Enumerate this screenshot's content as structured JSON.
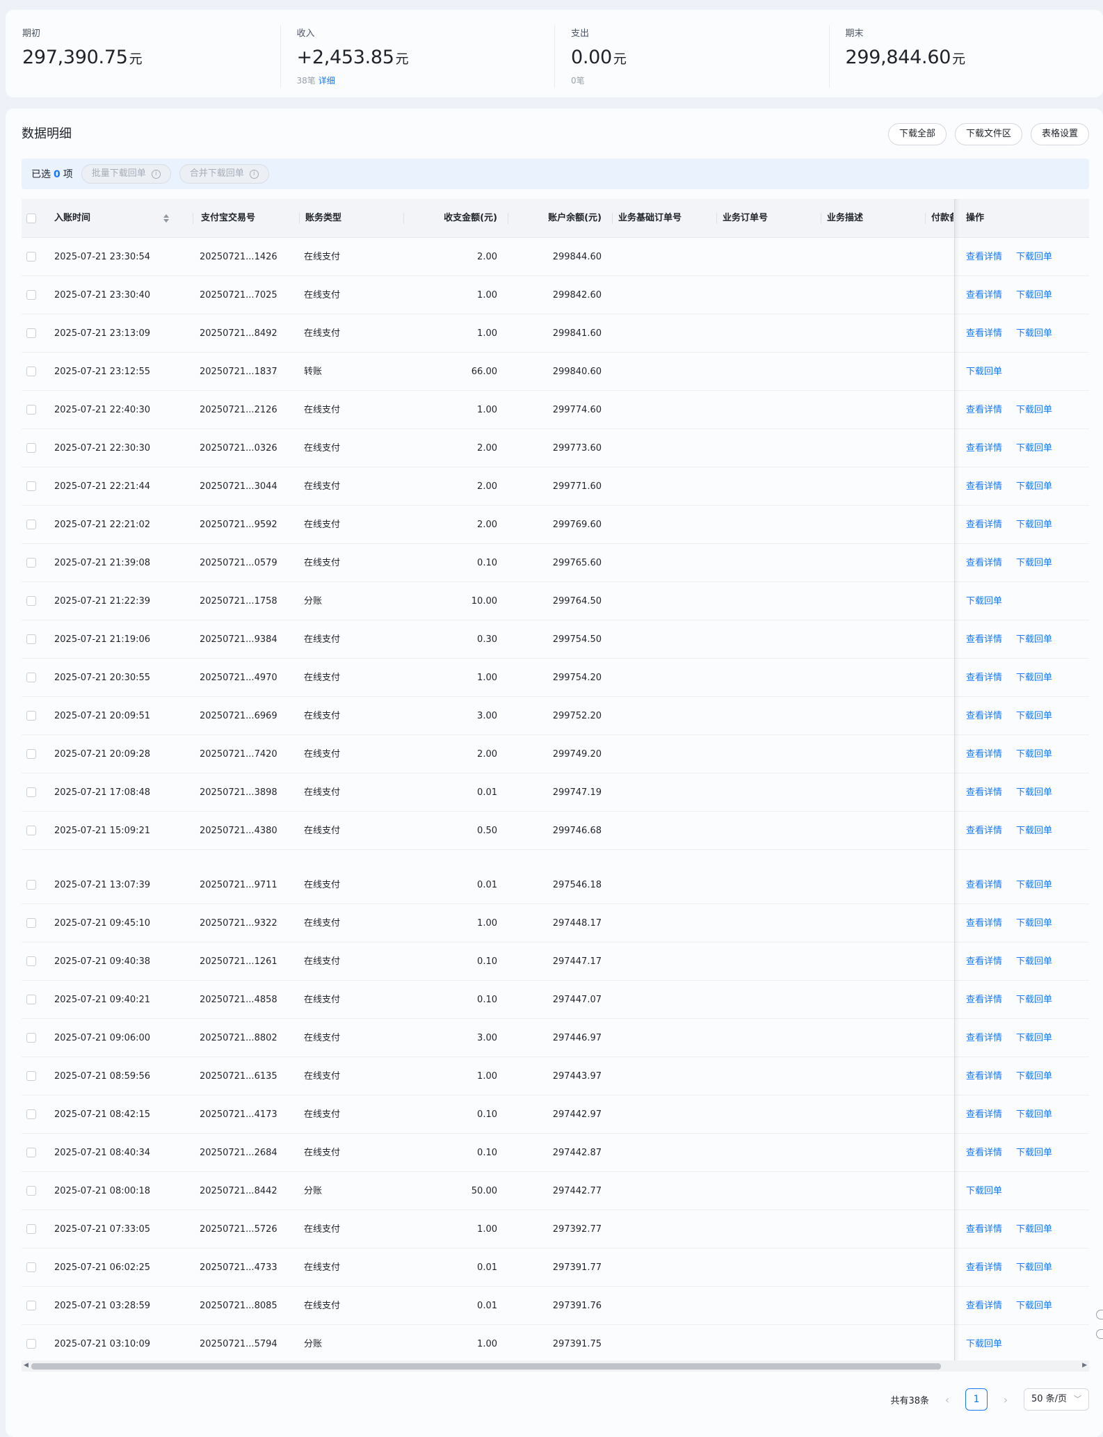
{
  "summary": [
    {
      "label": "期初",
      "value": "297,390.75",
      "unit": "元",
      "sub": "",
      "sub_link": ""
    },
    {
      "label": "收入",
      "value": "+2,453.85",
      "unit": "元",
      "sub": "38笔",
      "sub_link": "详细"
    },
    {
      "label": "支出",
      "value": "0.00",
      "unit": "元",
      "sub": "0笔",
      "sub_link": ""
    },
    {
      "label": "期末",
      "value": "299,844.60",
      "unit": "元",
      "sub": "",
      "sub_link": ""
    }
  ],
  "section_title": "数据明细",
  "toolbar": {
    "download_all": "下载全部",
    "download_files": "下载文件区",
    "table_settings": "表格设置"
  },
  "selection": {
    "prefix": "已选",
    "count": "0",
    "suffix": "项",
    "batch_download": "批量下载回单",
    "merge_download": "合并下载回单"
  },
  "columns": [
    "入账时间",
    "支付宝交易号",
    "账务类型",
    "收支金额(元)",
    "账户余额(元)",
    "业务基础订单号",
    "业务订单号",
    "业务描述",
    "付款备",
    "操作"
  ],
  "actions": {
    "view": "查看详情",
    "download": "下载回单"
  },
  "rows": [
    {
      "time": "2025-07-21 23:30:54",
      "trade_no": "20250721...1426",
      "type": "在线支付",
      "amount": "2.00",
      "balance": "299844.60",
      "view": true
    },
    {
      "time": "2025-07-21 23:30:40",
      "trade_no": "20250721...7025",
      "type": "在线支付",
      "amount": "1.00",
      "balance": "299842.60",
      "view": true
    },
    {
      "time": "2025-07-21 23:13:09",
      "trade_no": "20250721...8492",
      "type": "在线支付",
      "amount": "1.00",
      "balance": "299841.60",
      "view": true
    },
    {
      "time": "2025-07-21 23:12:55",
      "trade_no": "20250721...1837",
      "type": "转账",
      "amount": "66.00",
      "balance": "299840.60",
      "view": false
    },
    {
      "time": "2025-07-21 22:40:30",
      "trade_no": "20250721...2126",
      "type": "在线支付",
      "amount": "1.00",
      "balance": "299774.60",
      "view": true
    },
    {
      "time": "2025-07-21 22:30:30",
      "trade_no": "20250721...0326",
      "type": "在线支付",
      "amount": "2.00",
      "balance": "299773.60",
      "view": true
    },
    {
      "time": "2025-07-21 22:21:44",
      "trade_no": "20250721...3044",
      "type": "在线支付",
      "amount": "2.00",
      "balance": "299771.60",
      "view": true
    },
    {
      "time": "2025-07-21 22:21:02",
      "trade_no": "20250721...9592",
      "type": "在线支付",
      "amount": "2.00",
      "balance": "299769.60",
      "view": true
    },
    {
      "time": "2025-07-21 21:39:08",
      "trade_no": "20250721...0579",
      "type": "在线支付",
      "amount": "0.10",
      "balance": "299765.60",
      "view": true
    },
    {
      "time": "2025-07-21 21:22:39",
      "trade_no": "20250721...1758",
      "type": "分账",
      "amount": "10.00",
      "balance": "299764.50",
      "view": false
    },
    {
      "time": "2025-07-21 21:19:06",
      "trade_no": "20250721...9384",
      "type": "在线支付",
      "amount": "0.30",
      "balance": "299754.50",
      "view": true
    },
    {
      "time": "2025-07-21 20:30:55",
      "trade_no": "20250721...4970",
      "type": "在线支付",
      "amount": "1.00",
      "balance": "299754.20",
      "view": true
    },
    {
      "time": "2025-07-21 20:09:51",
      "trade_no": "20250721...6969",
      "type": "在线支付",
      "amount": "3.00",
      "balance": "299752.20",
      "view": true
    },
    {
      "time": "2025-07-21 20:09:28",
      "trade_no": "20250721...7420",
      "type": "在线支付",
      "amount": "2.00",
      "balance": "299749.20",
      "view": true
    },
    {
      "time": "2025-07-21 17:08:48",
      "trade_no": "20250721...3898",
      "type": "在线支付",
      "amount": "0.01",
      "balance": "299747.19",
      "view": true
    },
    {
      "time": "2025-07-21 15:09:21",
      "trade_no": "20250721...4380",
      "type": "在线支付",
      "amount": "0.50",
      "balance": "299746.68",
      "view": true
    },
    {
      "time": "2025-07-21 13:07:39",
      "trade_no": "20250721...9711",
      "type": "在线支付",
      "amount": "0.01",
      "balance": "297546.18",
      "view": true
    },
    {
      "time": "2025-07-21 09:45:10",
      "trade_no": "20250721...9322",
      "type": "在线支付",
      "amount": "1.00",
      "balance": "297448.17",
      "view": true
    },
    {
      "time": "2025-07-21 09:40:38",
      "trade_no": "20250721...1261",
      "type": "在线支付",
      "amount": "0.10",
      "balance": "297447.17",
      "view": true
    },
    {
      "time": "2025-07-21 09:40:21",
      "trade_no": "20250721...4858",
      "type": "在线支付",
      "amount": "0.10",
      "balance": "297447.07",
      "view": true
    },
    {
      "time": "2025-07-21 09:06:00",
      "trade_no": "20250721...8802",
      "type": "在线支付",
      "amount": "3.00",
      "balance": "297446.97",
      "view": true
    },
    {
      "time": "2025-07-21 08:59:56",
      "trade_no": "20250721...6135",
      "type": "在线支付",
      "amount": "1.00",
      "balance": "297443.97",
      "view": true
    },
    {
      "time": "2025-07-21 08:42:15",
      "trade_no": "20250721...4173",
      "type": "在线支付",
      "amount": "0.10",
      "balance": "297442.97",
      "view": true
    },
    {
      "time": "2025-07-21 08:40:34",
      "trade_no": "20250721...2684",
      "type": "在线支付",
      "amount": "0.10",
      "balance": "297442.87",
      "view": true
    },
    {
      "time": "2025-07-21 08:00:18",
      "trade_no": "20250721...8442",
      "type": "分账",
      "amount": "50.00",
      "balance": "297442.77",
      "view": false
    },
    {
      "time": "2025-07-21 07:33:05",
      "trade_no": "20250721...5726",
      "type": "在线支付",
      "amount": "1.00",
      "balance": "297392.77",
      "view": true
    },
    {
      "time": "2025-07-21 06:02:25",
      "trade_no": "20250721...4733",
      "type": "在线支付",
      "amount": "0.01",
      "balance": "297391.77",
      "view": true
    },
    {
      "time": "2025-07-21 03:28:59",
      "trade_no": "20250721...8085",
      "type": "在线支付",
      "amount": "0.01",
      "balance": "297391.76",
      "view": true
    },
    {
      "time": "2025-07-21 03:10:09",
      "trade_no": "20250721...5794",
      "type": "分账",
      "amount": "1.00",
      "balance": "297391.75",
      "view": false
    }
  ],
  "pagination": {
    "total": "共有38条",
    "current_page": "1",
    "page_size": "50 条/页"
  }
}
